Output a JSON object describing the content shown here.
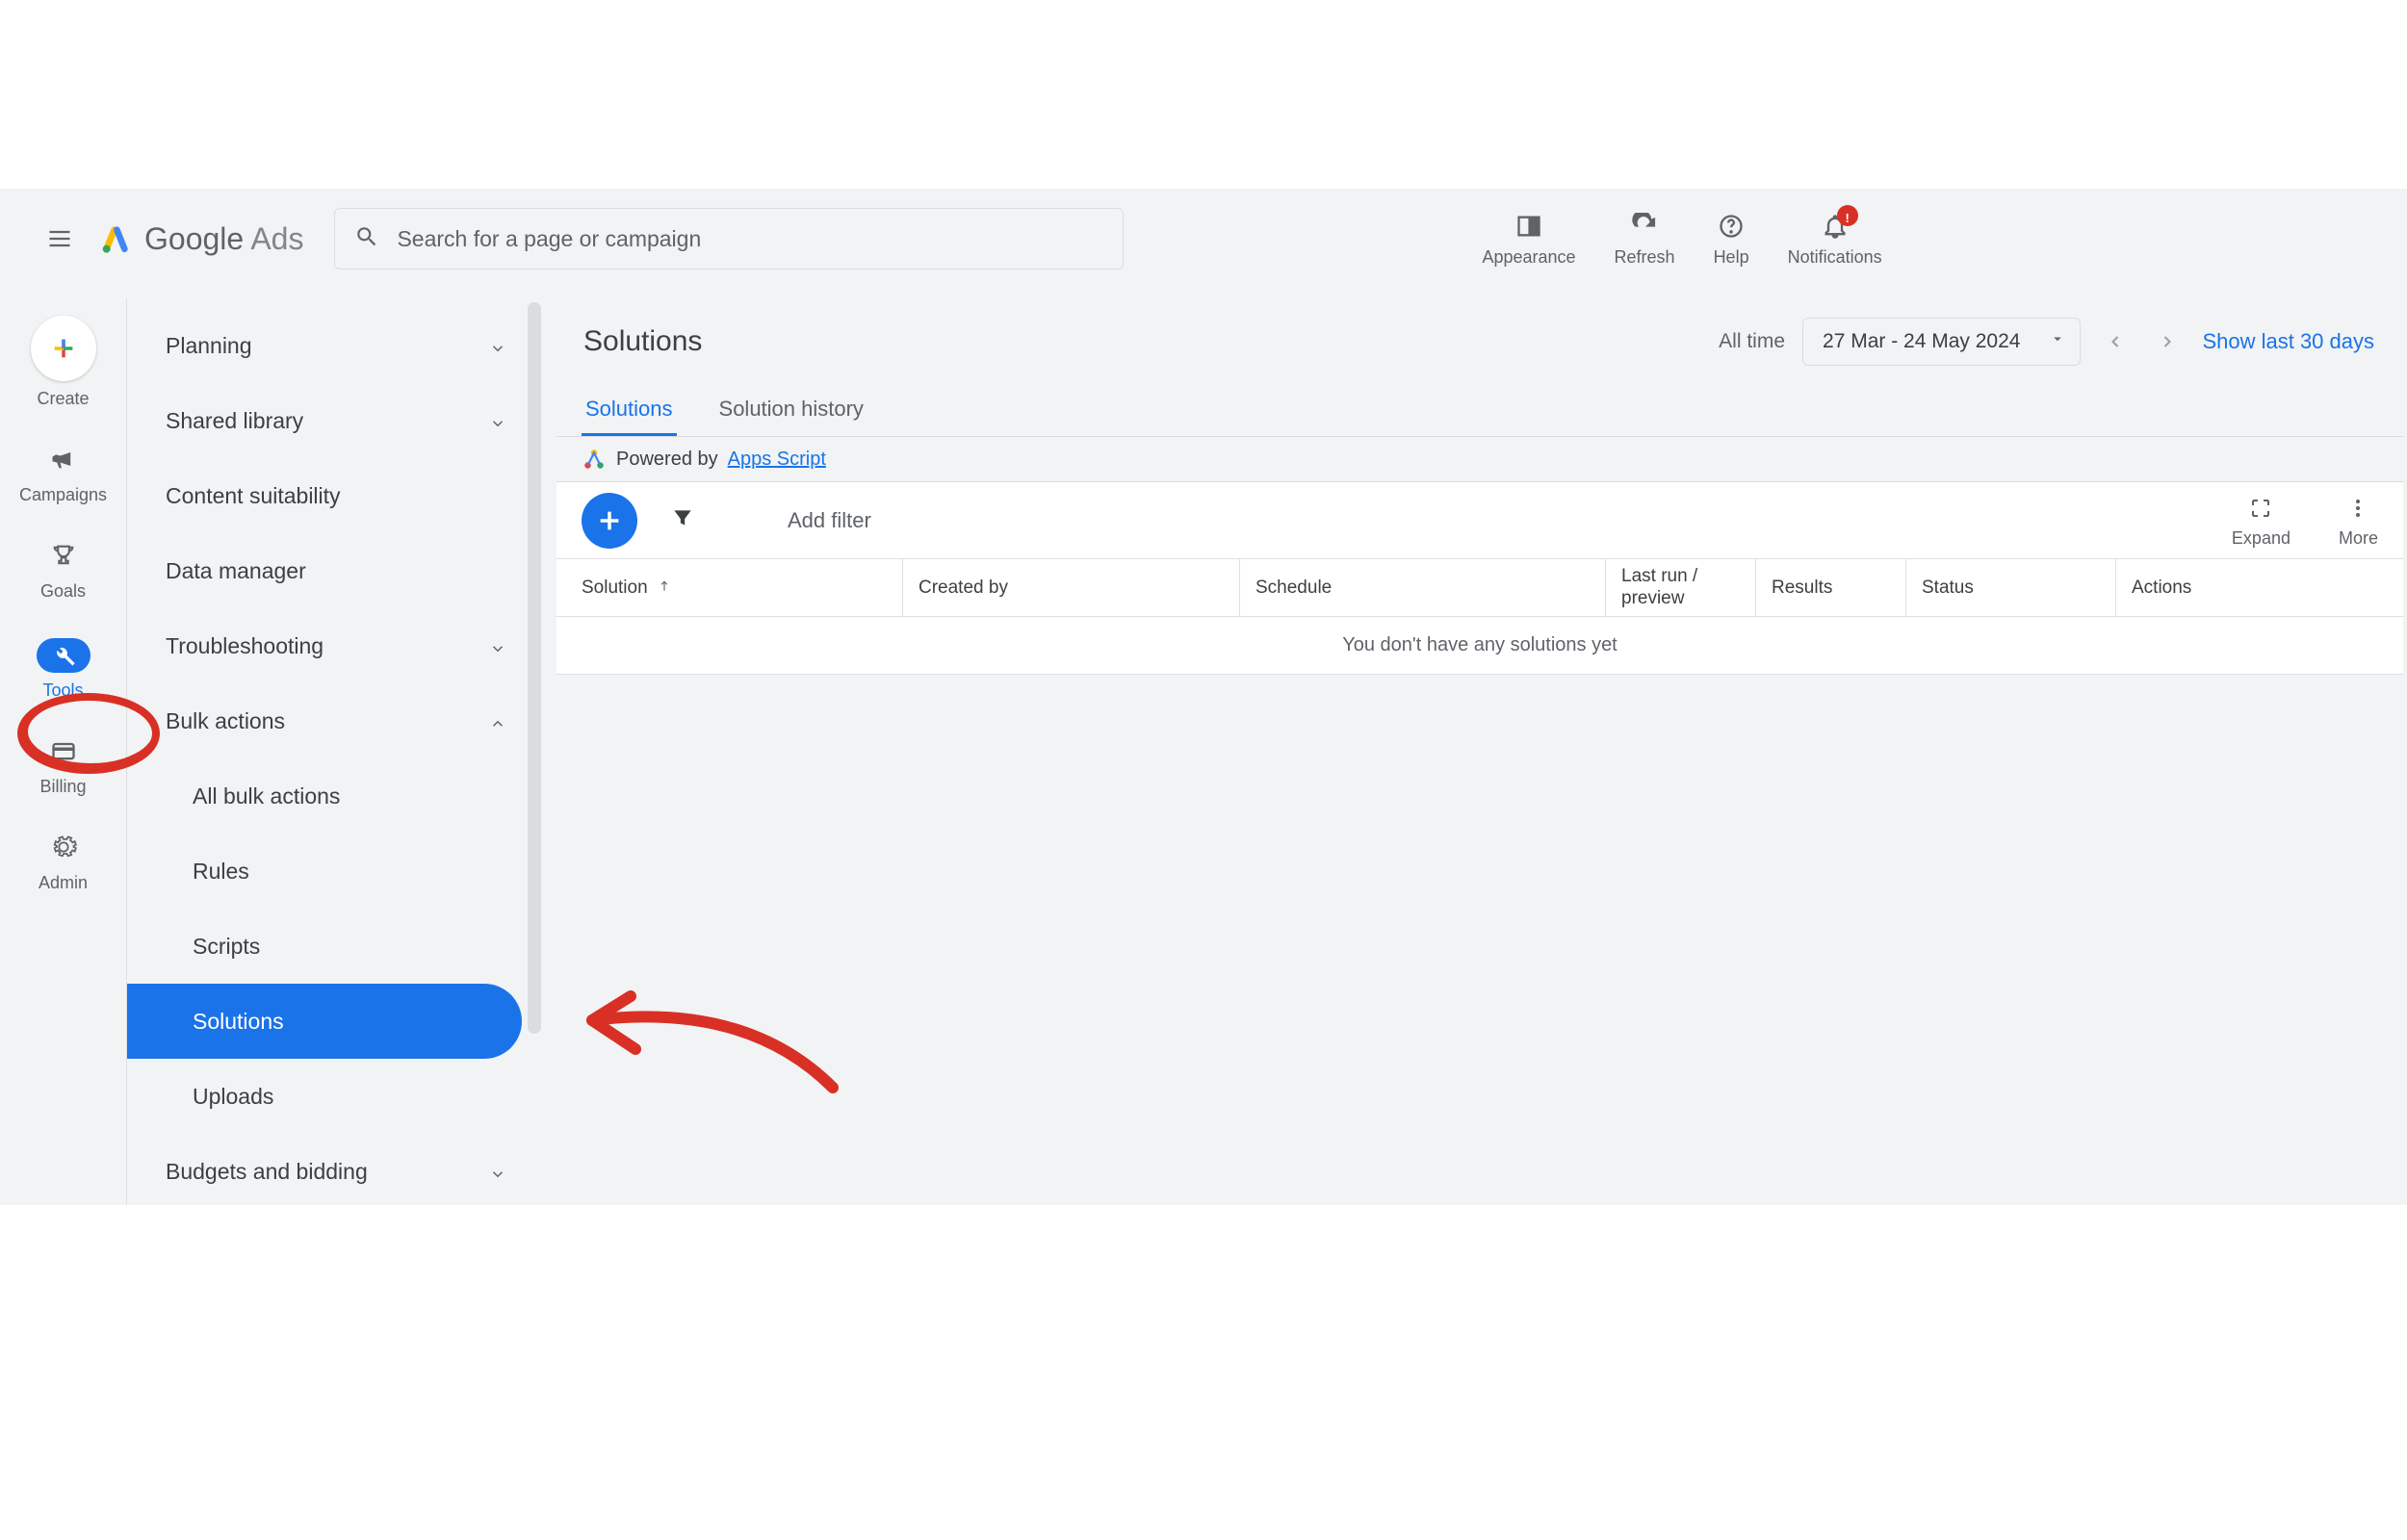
{
  "header": {
    "brand_google": "Google",
    "brand_ads": " Ads",
    "search_placeholder": "Search for a page or campaign",
    "actions": {
      "appearance": "Appearance",
      "refresh": "Refresh",
      "help": "Help",
      "notifications": "Notifications",
      "notif_badge": "!"
    }
  },
  "rail": {
    "create": "Create",
    "campaigns": "Campaigns",
    "goals": "Goals",
    "tools": "Tools",
    "billing": "Billing",
    "admin": "Admin"
  },
  "sidebar": {
    "planning": "Planning",
    "shared_library": "Shared library",
    "content_suitability": "Content suitability",
    "data_manager": "Data manager",
    "troubleshooting": "Troubleshooting",
    "bulk_actions": "Bulk actions",
    "bulk_children": {
      "all": "All bulk actions",
      "rules": "Rules",
      "scripts": "Scripts",
      "solutions": "Solutions",
      "uploads": "Uploads"
    },
    "budgets_bidding": "Budgets and bidding"
  },
  "main": {
    "title": "Solutions",
    "date_label": "All time",
    "date_range": "27 Mar - 24 May 2024",
    "show_last": "Show last 30 days",
    "tabs": {
      "solutions": "Solutions",
      "history": "Solution history"
    },
    "powered_by": "Powered by ",
    "apps_script": "Apps Script",
    "add_filter": "Add filter",
    "expand": "Expand",
    "more": "More",
    "columns": {
      "solution": "Solution",
      "created_by": "Created by",
      "schedule": "Schedule",
      "last_run": "Last run / preview",
      "results": "Results",
      "status": "Status",
      "actions": "Actions"
    },
    "empty": "You don't have any solutions yet"
  }
}
